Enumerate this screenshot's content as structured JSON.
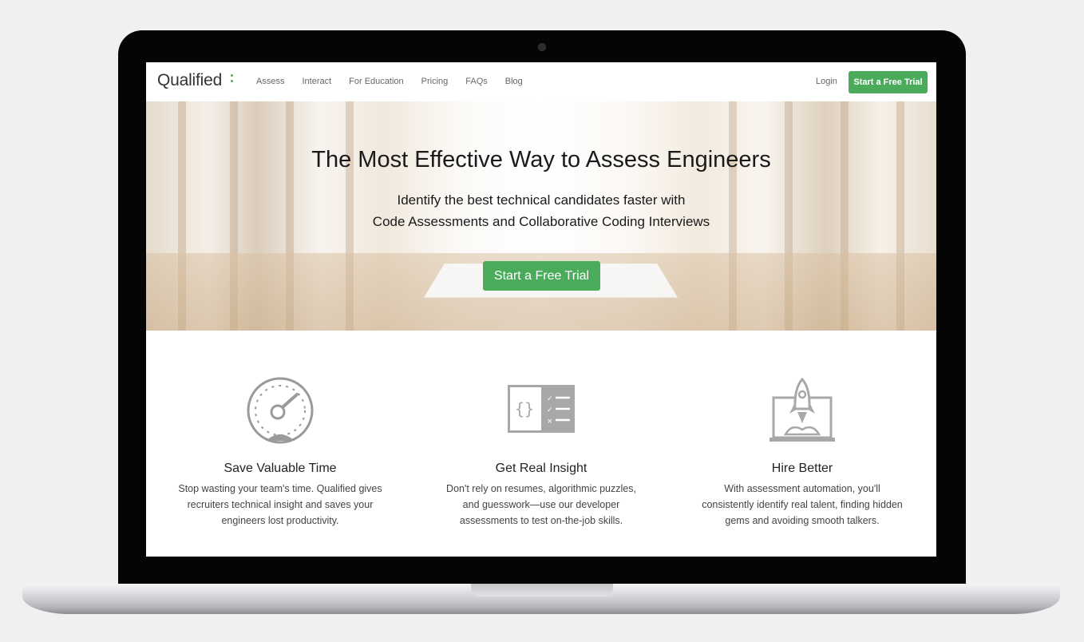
{
  "nav": {
    "logo": "Qualified",
    "links": [
      "Assess",
      "Interact",
      "For Education",
      "Pricing",
      "FAQs",
      "Blog"
    ],
    "login": "Login",
    "cta": "Start a Free Trial"
  },
  "hero": {
    "title": "The Most Effective Way to Assess Engineers",
    "subtitle_line1": "Identify the best technical candidates faster with",
    "subtitle_line2": "Code Assessments and Collaborative Coding Interviews",
    "cta": "Start a Free Trial"
  },
  "features": [
    {
      "icon": "speedometer-icon",
      "title": "Save Valuable Time",
      "text": "Stop wasting your team's time. Qualified gives recruiters technical insight and saves your engineers lost productivity."
    },
    {
      "icon": "code-checklist-icon",
      "title": "Get Real Insight",
      "text": "Don't rely on resumes, algorithmic puzzles, and guesswork—use our developer assessments to test on-the-job skills."
    },
    {
      "icon": "rocket-icon",
      "title": "Hire Better",
      "text": "With assessment automation, you'll consistently identify real talent, finding hidden gems and avoiding smooth talkers."
    }
  ],
  "colors": {
    "brand_green": "#4aac5b",
    "bezel": "#050505"
  }
}
